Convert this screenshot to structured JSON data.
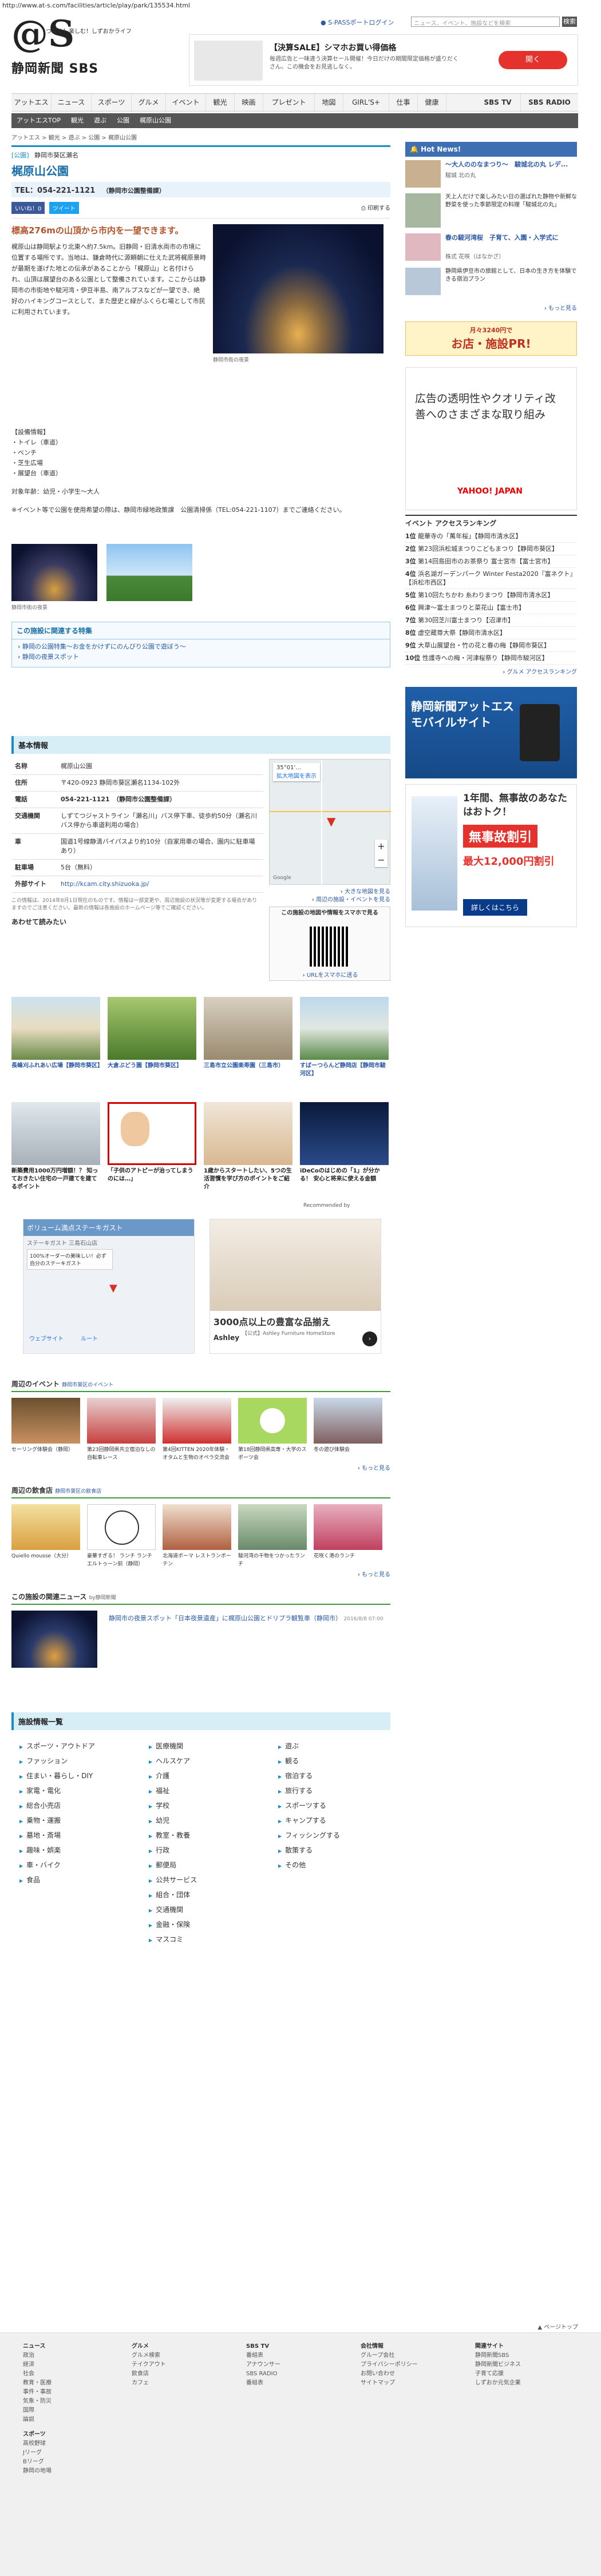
{
  "url": "http://www.at-s.com/facilities/article/play/park/135534.html",
  "header": {
    "logo_mark": "@S",
    "logo_tagline": "つなぐ！楽しむ！しずおかライフ",
    "logo_name": "静岡新聞 SBS",
    "pass_login": "S-PASSポートログイン",
    "search_placeholder": "ニュース、イベント、施設などを検索",
    "search_button": "検索"
  },
  "top_ad": {
    "title": "【決算SALE】シマホお買い得価格",
    "body": "毎週広告と一味違う決算セール開催！今日だけの期間限定価格が盛りだくさん。この機会をお見逃しなく。",
    "button": "開く"
  },
  "nav": [
    "アットエス",
    "ニュース",
    "スポーツ",
    "グルメ",
    "イベント",
    "観光",
    "映画",
    "プレゼント",
    "地図",
    "GIRL'S+",
    "仕事",
    "健康",
    "SBS TV",
    "SBS RADIO"
  ],
  "subnav": [
    "アットエスTOP",
    "観光",
    "遊ぶ",
    "公園",
    "梶原山公園"
  ],
  "breadcrumb": "アットエス > 観光 > 遊ぶ > 公園 > 梶原山公園",
  "facility": {
    "category": "[公園]",
    "area": "静岡市葵区瀬名",
    "name": "梶原山公園",
    "tel": "TEL：054-221-1121",
    "tel_note": "（静岡市公園整備課）",
    "like": "いいね！0",
    "tweet": "ツイート",
    "print": "印刷する",
    "lead": "標高276mの山頂から市内を一望できます。",
    "desc": "梶原山は静岡駅より北東へ約7.5km。旧静岡・旧清水両市の市境に位置する場所です。当地は、鎌倉時代に源頼朝に仕えた武将梶原景時が最期を遂げた地との伝承があることから「梶原山」と名付けられ、山頂は展望台のある公園として整備されています。ここからは静岡市の市街地や駿河湾・伊豆半島、南アルプスなどが一望でき、絶好のハイキングコースとして、また歴史と緑がふくらむ場として市民に利用されています。",
    "facilities_title": "【設備情報】",
    "facilities": [
      "トイレ（車道）",
      "ベンチ",
      "芝生広場",
      "展望台（車道）"
    ],
    "target": "対象年齢：幼児・小学生〜大人",
    "note": "※イベント等で公園を使用希望の際は、静岡市緑地政策課　公園清掃係（TEL:054-221-1107）までご連絡ください。",
    "main_photo_caption": "静岡市街の夜景",
    "small_photo_caption": "静岡市街の夜景"
  },
  "related": {
    "title": "この施設に関連する特集",
    "items": [
      "静岡の公園特集〜お金をかけずにのんびり公園で遊ぼう〜",
      "静岡の夜景スポット"
    ]
  },
  "basic": {
    "title": "基本情報",
    "rows": [
      {
        "k": "名称",
        "v": "梶原山公園"
      },
      {
        "k": "住所",
        "v": "〒420-0923 静岡市葵区瀬名1134-102外"
      },
      {
        "k": "電話",
        "v": "054-221-1121　（静岡市公園整備課）"
      },
      {
        "k": "交通機関",
        "v": "しずてつジャストライン「瀬名川」バス停下車、徒歩約50分（瀬名川バス停から車道利用の場合）"
      },
      {
        "k": "車",
        "v": "国道1号線静清バイパスより約10分（自家用車の場合、園内に駐車場あり）"
      },
      {
        "k": "駐車場",
        "v": "5台（無料）"
      },
      {
        "k": "外部サイト",
        "v": "http://kcam.city.shizuoka.jp/"
      }
    ],
    "disclaimer": "この情報は、2014年8月1日現在のものです。情報は一部変更や、周辺施設の状況等が変更する場合がありますのでご注意ください。最新の情報は各施設のホームページ等でご確認ください。",
    "near_title": "あわせて読みたい",
    "map_coords": "35°01'…",
    "map_link": "拡大地図を表示",
    "map_bottom1": "大きな地図を見る",
    "map_bottom2": "周辺の施設・イベントを見る",
    "qr_title": "この施設の地図や情報をスマホで見る",
    "qr_link": "URLをスマホに送る"
  },
  "nearby_top": [
    {
      "title": "長峰刈ふれあい広場【静岡市葵区】"
    },
    {
      "title": "大倉ぶどう園【静岡市葵区】"
    },
    {
      "title": "三島市立公園楽寿園（三島市）"
    },
    {
      "title": "すばーつらんど静岡店【静岡市駿河区】"
    }
  ],
  "recommend": [
    {
      "title": "新築費用1000万円増額！？ 知っておきたい住宅の一戸建てを建てるポイント"
    },
    {
      "title": "「子供のアトピーが治ってしまうのには…」"
    },
    {
      "title": "1歳からスタートしたい、5つの生活習慣を学び方のポイントをご紹介"
    },
    {
      "title": "iDeCoのはじめの「1」が分かる！ 安心と将来に使える金額"
    }
  ],
  "recommend_by": "Recommended by",
  "gmap_ad": {
    "name": "ボリューム満点ステーキガスト",
    "sub": "ステーキガスト 三島石山店",
    "badge": "100%オーダーの美味しい！必ず自分のステーキガスト",
    "route": "ウェブサイト",
    "route2": "ルート"
  },
  "furniture_ad": {
    "title": "3000点以上の豊富な品揃え",
    "sub": "【公式】Ashley Furniture HomeStore",
    "brand": "Ashley"
  },
  "events": {
    "title": "周辺のイベント",
    "tag": "静岡市葵区のイベント",
    "items": [
      "セーリング体験会（静岡）",
      "第23回静岡県共立宿泊なしの自転車レース",
      "第4回KITTEN 2020年体験・オタムと生物のオペラ交流会",
      "第18回静岡県高専・大学のスポーツ会",
      "冬の遊び体験会"
    ],
    "more": "もっと見る"
  },
  "gourmet": {
    "title": "周辺の飲食店",
    "tag": "静岡市葵区の飲食店",
    "items": [
      "Quiello mousse（大分）",
      "豪華すぎる！ ランチ ランチエルトゥーン前（静岡）",
      "北海道ボーマ レストランボーテン",
      "駿河湾の干物をつかったランチ",
      "花咲く港のランチ"
    ],
    "more": "もっと見る"
  },
  "news": {
    "title": "この施設の関連ニュース",
    "tag": "by静岡新聞",
    "item": "静岡市の夜景スポット「日本夜景遺産」に梶原山公園とドリプラ観覧車（静岡市）",
    "date": "2016/8/8 07:00"
  },
  "categories": {
    "title": "施設情報一覧",
    "col1": [
      "スポーツ・アウトドア",
      "ファッション",
      "住まい・暮らし・DIY",
      "家電・電化",
      "総合小売店",
      "乗物・運搬",
      "墓地・斎場",
      "趣味・娯楽",
      "車・バイク",
      "食品"
    ],
    "col2": [
      "医療機関",
      "ヘルスケア",
      "介護",
      "福祉",
      "学校",
      "幼児",
      "教室・教養",
      "行政",
      "郵便局",
      "公共サービス",
      "組合・団体",
      "交通機関",
      "金融・保険",
      "マスコミ"
    ],
    "col3": [
      "遊ぶ",
      "観る",
      "宿泊する",
      "旅行する",
      "スポーツする",
      "キャンプする",
      "フィッシングする",
      "散策する",
      "その他"
    ],
    "more": "もっと見る"
  },
  "side": {
    "hotnews": "Hot News!",
    "hot_items": [
      {
        "title": "〜大人ののなまつり〜　駿城北の丸 レデ...",
        "sub": "駿城 北の丸"
      },
      {
        "title": "天上人だけで楽しみたい日の選ばれた静物や新鮮な野菜を使った季節限定の料理「駿城北の丸」",
        "sub": ""
      },
      {
        "title": "春の駿河湾桜　子育て、入園・入学式に",
        "sub": "株式 花咲（はなかざ）"
      },
      {
        "title": "静岡県伊豆市の旅館として、日本の生き方を体験できる宿泊プラン",
        "sub": ""
      }
    ],
    "more": "もっと見る",
    "banner_price": "月々3240円で",
    "banner_main": "お店・施設PR!",
    "ad_title": "広告の透明性やクオリティ改善へのさまざまな取り組み",
    "ad_brand": "YAHOO! JAPAN",
    "ranking_title": "イベント アクセスランキング",
    "ranking": [
      "龍華寺の「萬年桜」【静岡市清水区】",
      "第23回浜松城まつりこどもまつり【静岡市葵区】",
      "第14回島田市のお茶祭り 富士宮市【富士宮市】",
      "浜名湖ガーデンパーク Winter Festa2020『富ネクト』【浜松市西区】",
      "第10回たちかわ 糸わりまつり【静岡市清水区】",
      "興津〜富士まつりと菜花山【富士市】",
      "第30回芝川富士まつり【沼津市】",
      "虚空蔵尊大祭【静岡市清水区】",
      "大草山展望台・竹の花と春の梅【静岡市葵区】",
      "性護寺への梅・河津桜祭り【静岡市駿河区】"
    ],
    "ranking_more": "グルメ アクセスランキング",
    "mobile_title": "静岡新聞アットエス モバイルサイト",
    "sony_title": "1年間、無事故のあなたはおトク！",
    "sony_main": "無事故割引",
    "sony_price": "最大12,000円割引",
    "sony_btn": "詳しくはこちら"
  },
  "footer": {
    "cols": [
      {
        "head": "ニュース",
        "items": [
          "政治",
          "経済",
          "社会",
          "教育・医療",
          "事件・事故",
          "気象・防災",
          "国際",
          "論説",
          "スポーツ",
          "野球",
          "サッカー",
          "ゴルフ",
          "その他",
          "芸能"
        ]
      },
      {
        "head": "スポーツ",
        "items": [
          "高校野球",
          "Jリーグ",
          "Bリーグ",
          "静岡の地場"
        ]
      },
      {
        "head": "グルメ",
        "items": [
          "グルメ検索",
          "テイクアウト",
          "飲食店",
          "カフェ"
        ]
      },
      {
        "head": "SBS TV",
        "items": [
          "番組表",
          "アナウンサー",
          "SBS RADIO",
          "番組表"
        ]
      },
      {
        "head": "会社情報",
        "items": [
          "グループ会社",
          "プライバシーポリシー",
          "お問い合わせ",
          "サイトマップ"
        ]
      },
      {
        "head": "関連サイト",
        "items": [
          "静岡新聞SBS",
          "静岡新聞ビジネス",
          "子育て応援",
          "しずおか元気企業"
        ]
      }
    ],
    "pagetop": "ページトップ"
  }
}
